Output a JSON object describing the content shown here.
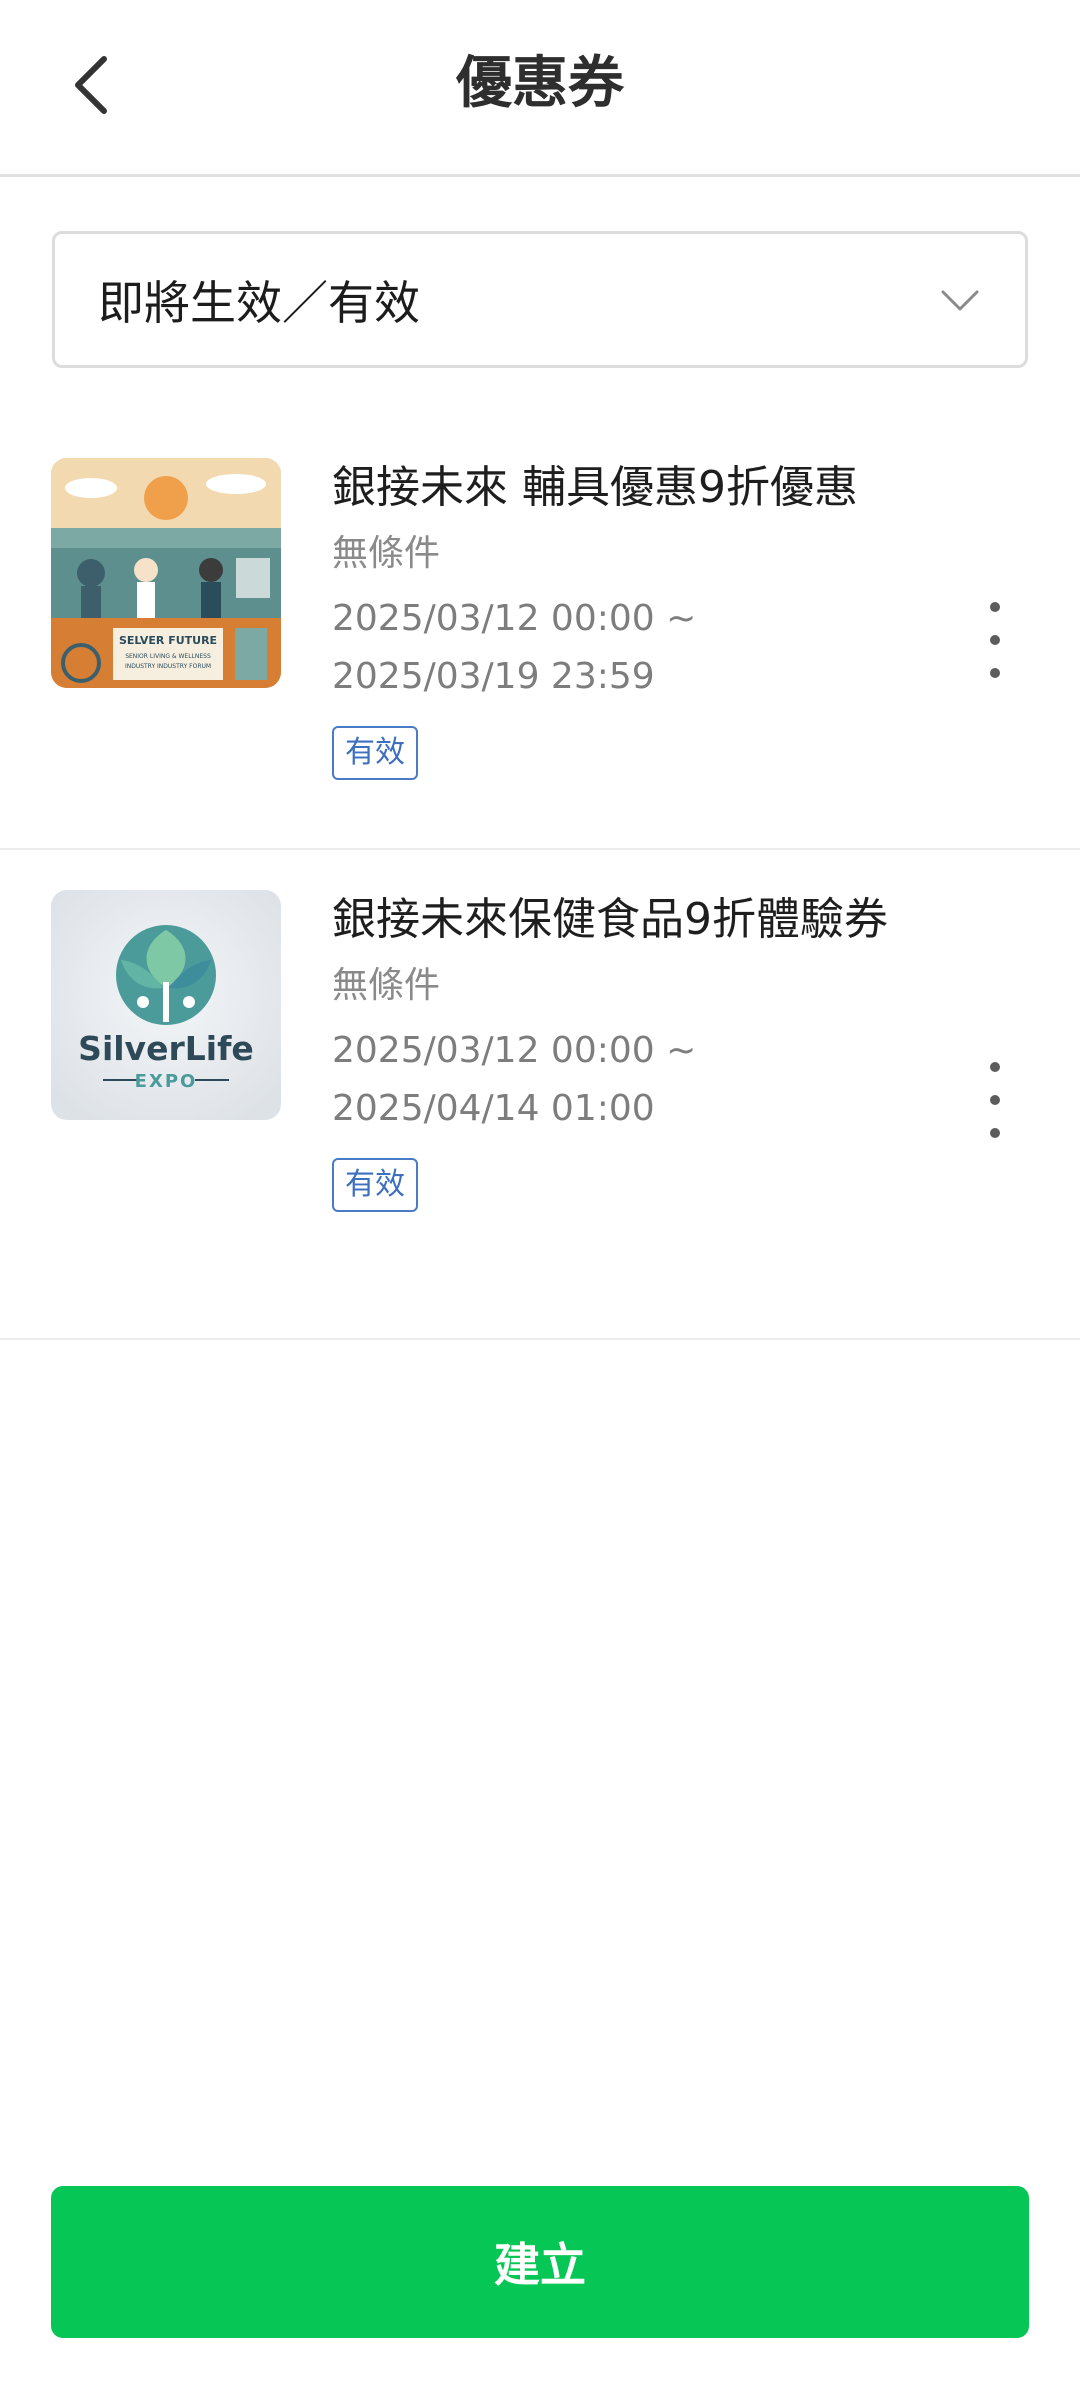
{
  "header": {
    "title": "優惠券",
    "back_icon": "chevron-left-icon"
  },
  "filter": {
    "selected": "即將生效／有效",
    "icon": "chevron-down-icon"
  },
  "coupons": [
    {
      "title": "銀接未來 輔具優惠9折優惠",
      "condition": "無條件",
      "date_range": "2025/03/12 00:00 ~ 2025/03/19 23:59",
      "status": "有效",
      "thumbnail": {
        "line1": "SELVER FUTURE",
        "line2": "SENIOR LIVING & WELLNESS",
        "line3": "INDUSTRY INDUSTRY FORUM"
      }
    },
    {
      "title": "銀接未來保健食品9折體驗券",
      "condition": "無條件",
      "date_range": "2025/03/12 00:00 ~ 2025/04/14 01:00",
      "status": "有效",
      "thumbnail": {
        "line1": "SilverLife",
        "line2": "EXPO"
      }
    }
  ],
  "create_button": {
    "label": "建立"
  },
  "colors": {
    "primary_green": "#06c755",
    "badge_blue": "#3d6fc0",
    "divider": "#ececec"
  }
}
